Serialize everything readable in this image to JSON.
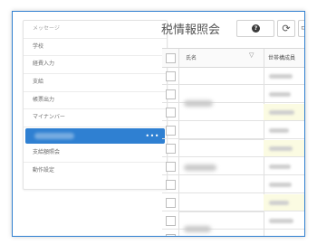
{
  "sidebar": {
    "items": [
      {
        "label": "メッセージ"
      },
      {
        "label": "学校"
      },
      {
        "label": "経費入力"
      },
      {
        "label": "支給"
      },
      {
        "label": "帳票出力"
      },
      {
        "label": "マイナンバー"
      },
      {
        "label": ""
      },
      {
        "label": "支給額照会"
      },
      {
        "label": "動作設定"
      }
    ],
    "selected_index": 6,
    "more_icon": "more-dots-icon"
  },
  "header": {
    "title": "税情報照会",
    "help_icon": "question-circle-icon",
    "refresh_icon": "refresh-icon"
  },
  "table": {
    "columns": [
      "氏名",
      "世帯構成員"
    ],
    "filter_icon": "filter-icon"
  },
  "colors": {
    "accent": "#2f80d2",
    "highlight_row": "#fbfbe2"
  }
}
